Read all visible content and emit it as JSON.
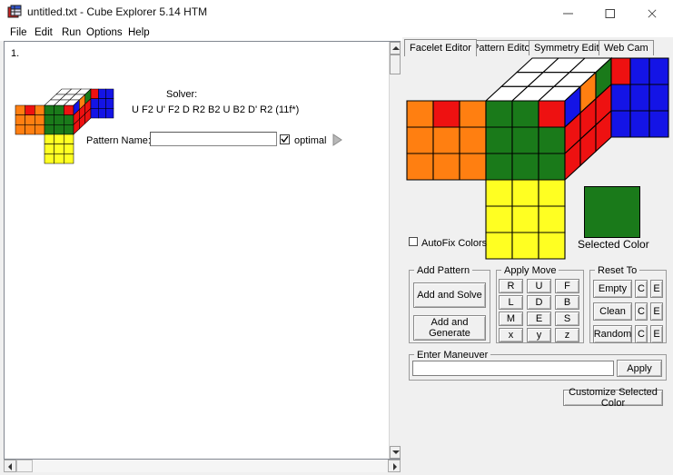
{
  "window": {
    "title": "untitled.txt - Cube Explorer 5.14 HTM",
    "icon": "cube-explorer-icon",
    "minimize": "minimize-icon",
    "maximize": "maximize-icon",
    "close": "close-icon"
  },
  "menu": {
    "items": [
      {
        "label": "File"
      },
      {
        "label": "Edit"
      },
      {
        "label": "Run"
      },
      {
        "label": "Options"
      },
      {
        "label": "Help"
      }
    ]
  },
  "left_pane": {
    "item_number": "1.",
    "solver_label": "Solver:",
    "solver_value": "U F2 U' F2 D R2 B2 U B2 D' R2  (11f*)",
    "pattern_name_label": "Pattern Name:",
    "pattern_name_value": "",
    "pattern_name_placeholder": "",
    "optimal_label": "optimal",
    "optimal_checked": true,
    "next_arrow": "play-arrow-icon"
  },
  "right_pane": {
    "tabs": [
      {
        "label": "Facelet Editor",
        "active": true
      },
      {
        "label": "Pattern Editor",
        "active": false
      },
      {
        "label": "Symmetry Editor",
        "active": false
      },
      {
        "label": "Web Cam",
        "active": false
      }
    ],
    "autofix_label": "AutoFix Colors",
    "autofix_checked": false,
    "selected_color_label": "Selected Color",
    "selected_color_value": "#1a7a1a",
    "add_pattern": {
      "caption": "Add Pattern",
      "add_and_solve": "Add and Solve",
      "add_and_generate": "Add and Generate"
    },
    "apply_move": {
      "caption": "Apply Move",
      "buttons": [
        "R",
        "U",
        "F",
        "L",
        "D",
        "B",
        "M",
        "E",
        "S",
        "x",
        "y",
        "z"
      ]
    },
    "reset_to": {
      "caption": "Reset To",
      "rows": [
        {
          "main": "Empty",
          "c": "C",
          "e": "E"
        },
        {
          "main": "Clean",
          "c": "C",
          "e": "E"
        },
        {
          "main": "Random",
          "c": "C",
          "e": "E"
        }
      ]
    },
    "enter_maneuver": {
      "caption": "Enter Maneuver",
      "value": "",
      "placeholder": "",
      "apply_label": "Apply"
    },
    "customize_label": "Customize Selected Color"
  },
  "palette": {
    "white": "#ffffff",
    "red": "#ee1111",
    "blue": "#1414e6",
    "orange": "#ff7f11",
    "green": "#1a7a1a",
    "yellow": "#ffff22",
    "outline": "#000000"
  },
  "cube_state": {
    "up_face": [
      [
        "white",
        "white",
        "white"
      ],
      [
        "white",
        "white",
        "white"
      ],
      [
        "white",
        "white",
        "white"
      ]
    ],
    "left_face": [
      [
        "orange",
        "red",
        "orange"
      ],
      [
        "orange",
        "orange",
        "orange"
      ],
      [
        "orange",
        "orange",
        "orange"
      ]
    ],
    "front_face": [
      [
        "green",
        "green",
        "red"
      ],
      [
        "green",
        "green",
        "green"
      ],
      [
        "green",
        "green",
        "green"
      ]
    ],
    "right_face": [
      [
        "blue",
        "orange",
        "green"
      ],
      [
        "red",
        "red",
        "red"
      ],
      [
        "red",
        "red",
        "red"
      ]
    ],
    "back_face": [
      [
        "red",
        "blue",
        "blue"
      ],
      [
        "blue",
        "blue",
        "blue"
      ],
      [
        "blue",
        "blue",
        "blue"
      ]
    ],
    "down_face": [
      [
        "yellow",
        "yellow",
        "yellow"
      ],
      [
        "yellow",
        "yellow",
        "yellow"
      ],
      [
        "yellow",
        "yellow",
        "yellow"
      ]
    ]
  },
  "scrollbars": {
    "vertical": "vertical-scrollbar",
    "horizontal": "horizontal-scrollbar"
  }
}
